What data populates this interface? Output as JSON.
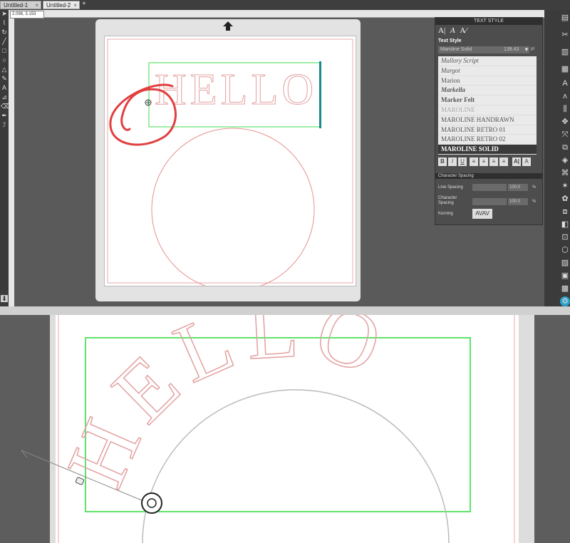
{
  "tabs": [
    {
      "label": "Untitled-1"
    },
    {
      "label": "Untitled-2"
    }
  ],
  "add_tab_label": "+",
  "coordinates": "2.098, 3.153",
  "canvas": {
    "text": "HELLO"
  },
  "text_style_panel": {
    "title": "TEXT STYLE",
    "section_label": "Text Style",
    "font_name": "Maroline Solid",
    "font_size": "139.43",
    "font_unit": "pt",
    "fonts": [
      "Mallory Script",
      "Margot",
      "Marion",
      "Markella",
      "Marker Felt",
      "MAROLINE",
      "MAROLINE HANDRAWN",
      "MAROLINE RETRO 01",
      "MAROLINE RETRO 02",
      "MAROLINE SOLID"
    ],
    "selected_font_index": 9,
    "format_buttons": [
      "B",
      "I",
      "U"
    ],
    "character_spacing": {
      "title": "Character Spacing",
      "line_spacing_label": "Line Spacing",
      "line_spacing_value": "100.0",
      "char_spacing_label_1": "Character",
      "char_spacing_label_2": "Spacing",
      "char_spacing_value": "100.0",
      "unit": "%",
      "kerning_label": "Kerning",
      "kerning_value": "AVAV"
    }
  },
  "colors": {
    "selection_green": "#5fe36a",
    "cut_line_red": "#e89090",
    "annotation_red": "#e04040",
    "handle_teal": "#1a8a8a"
  }
}
